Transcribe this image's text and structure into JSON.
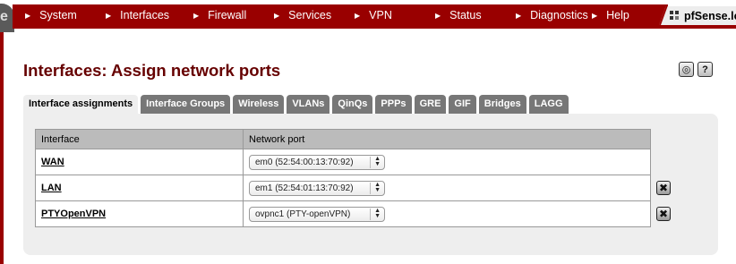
{
  "nav": {
    "items": [
      {
        "label": "System"
      },
      {
        "label": "Interfaces"
      },
      {
        "label": "Firewall"
      },
      {
        "label": "Services"
      },
      {
        "label": "VPN"
      },
      {
        "label": "Status"
      },
      {
        "label": "Diagnostics"
      },
      {
        "label": "Help"
      }
    ],
    "brand": "pfSense.lo",
    "logo_letter": "e"
  },
  "page": {
    "title": "Interfaces: Assign network ports"
  },
  "tabs": [
    {
      "label": "Interface assignments",
      "active": true
    },
    {
      "label": "Interface Groups"
    },
    {
      "label": "Wireless"
    },
    {
      "label": "VLANs"
    },
    {
      "label": "QinQs"
    },
    {
      "label": "PPPs"
    },
    {
      "label": "GRE"
    },
    {
      "label": "GIF"
    },
    {
      "label": "Bridges"
    },
    {
      "label": "LAGG"
    }
  ],
  "table": {
    "headers": {
      "interface": "Interface",
      "port": "Network port"
    },
    "rows": [
      {
        "interface": "WAN",
        "port": "em0 (52:54:00:13:70:92)"
      },
      {
        "interface": "LAN",
        "port": "em1 (52:54:01:13:70:92)"
      },
      {
        "interface": "PTYOpenVPN",
        "port": "ovpnc1 (PTY-openVPN)"
      }
    ]
  },
  "colors": {
    "brand_red": "#990000",
    "title_red": "#660000",
    "tab_gray": "#777777",
    "panel_gray": "#eeeeee"
  }
}
